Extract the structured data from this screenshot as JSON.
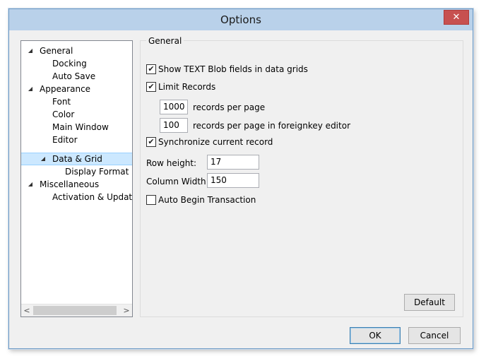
{
  "window": {
    "title": "Options",
    "close_symbol": "✕"
  },
  "tree": {
    "items": [
      {
        "label": "General",
        "expander": "◢"
      },
      {
        "label": "Docking"
      },
      {
        "label": "Auto Save"
      },
      {
        "label": "Appearance",
        "expander": "◢"
      },
      {
        "label": "Font"
      },
      {
        "label": "Color"
      },
      {
        "label": "Main Window"
      },
      {
        "label": "Editor"
      },
      {
        "label": "Data & Grid",
        "expander": "◢",
        "selected": true
      },
      {
        "label": "Display Format"
      },
      {
        "label": "Miscellaneous",
        "expander": "◢"
      },
      {
        "label": "Activation & Updater"
      }
    ],
    "scroll_left": "<",
    "scroll_right": ">"
  },
  "panel": {
    "group_title": "General",
    "show_blob": {
      "label": "Show TEXT Blob fields in data grids",
      "checked": true
    },
    "limit_records": {
      "label": "Limit Records",
      "checked": true
    },
    "records_per_page": {
      "value": "1000",
      "label": "records per page"
    },
    "records_fk": {
      "value": "100",
      "label": "records per page in foreignkey editor"
    },
    "sync_record": {
      "label": "Synchronize current record",
      "checked": true
    },
    "row_height": {
      "label": "Row height:",
      "value": "17"
    },
    "column_width": {
      "label": "Column Width:",
      "value": "150"
    },
    "auto_begin": {
      "label": "Auto Begin Transaction",
      "checked": false
    },
    "default_button": "Default"
  },
  "footer": {
    "ok_button": "OK",
    "cancel_button": "Cancel"
  },
  "checkmark": "✔"
}
